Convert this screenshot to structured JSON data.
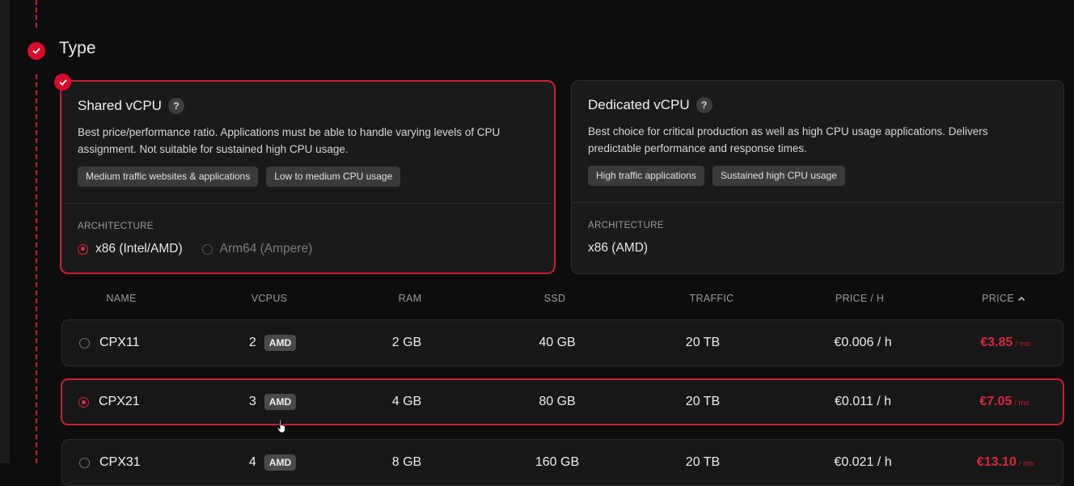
{
  "step": {
    "title": "Type"
  },
  "cards": [
    {
      "title": "Shared vCPU",
      "help": "?",
      "description": "Best price/performance ratio. Applications must be able to handle varying levels of CPU assignment. Not suitable for sustained high CPU usage.",
      "tags": [
        "Medium traffic websites & applications",
        "Low to medium CPU usage"
      ],
      "architecture_label": "ARCHITECTURE",
      "arch_options": [
        "x86 (Intel/AMD)",
        "Arm64 (Ampere)"
      ]
    },
    {
      "title": "Dedicated vCPU",
      "help": "?",
      "description": "Best choice for critical production as well as high CPU usage applications. Delivers predictable performance and response times.",
      "tags": [
        "High traffic applications",
        "Sustained high CPU usage"
      ],
      "architecture_label": "ARCHITECTURE",
      "arch_value": "x86 (AMD)"
    }
  ],
  "table": {
    "headers": {
      "name": "NAME",
      "vcpus": "VCPUS",
      "ram": "RAM",
      "ssd": "SSD",
      "traffic": "TRAFFIC",
      "price_h": "PRICE / H",
      "price": "PRICE"
    },
    "rows": [
      {
        "name": "CPX11",
        "vcpus": "2",
        "badge": "AMD",
        "ram": "2 GB",
        "ssd": "40 GB",
        "traffic": "20 TB",
        "price_h": "€0.006 / h",
        "price": "€3.85",
        "per": "/ mo"
      },
      {
        "name": "CPX21",
        "vcpus": "3",
        "badge": "AMD",
        "ram": "4 GB",
        "ssd": "80 GB",
        "traffic": "20 TB",
        "price_h": "€0.011 / h",
        "price": "€7.05",
        "per": "/ mo"
      },
      {
        "name": "CPX31",
        "vcpus": "4",
        "badge": "AMD",
        "ram": "8 GB",
        "ssd": "160 GB",
        "traffic": "20 TB",
        "price_h": "€0.021 / h",
        "price": "€13.10",
        "per": "/ mo"
      }
    ]
  },
  "colors": {
    "accent": "#d50c2d",
    "background": "#0d0d0d",
    "card": "#1a1a1a"
  },
  "icons": [
    "check-icon",
    "help-icon",
    "sort-up-icon",
    "pointer-cursor-icon"
  ]
}
